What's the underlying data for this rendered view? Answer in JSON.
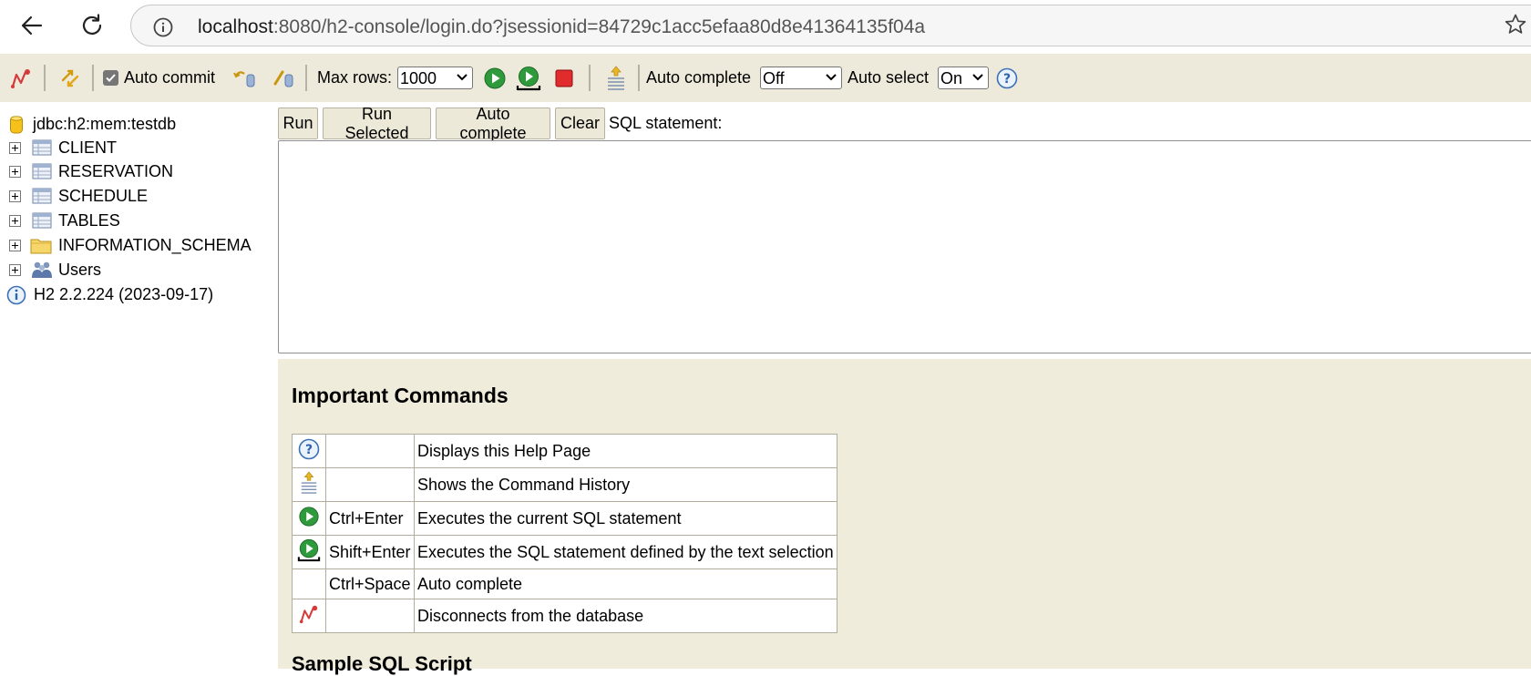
{
  "browser": {
    "url_host": "localhost",
    "url_rest": ":8080/h2-console/login.do?jsessionid=84729c1acc5efaa80d8e41364135f04a"
  },
  "toolbar": {
    "auto_commit_label": "Auto commit",
    "auto_commit_checked": true,
    "max_rows_label": "Max rows:",
    "max_rows_value": "1000",
    "auto_complete_label": "Auto complete",
    "auto_complete_value": "Off",
    "auto_select_label": "Auto select",
    "auto_select_value": "On"
  },
  "tree": {
    "connection": "jdbc:h2:mem:testdb",
    "items": [
      {
        "label": "CLIENT",
        "icon": "table-icon"
      },
      {
        "label": "RESERVATION",
        "icon": "table-icon"
      },
      {
        "label": "SCHEDULE",
        "icon": "table-icon"
      },
      {
        "label": "TABLES",
        "icon": "table-icon"
      },
      {
        "label": "INFORMATION_SCHEMA",
        "icon": "folder-icon"
      },
      {
        "label": "Users",
        "icon": "users-icon"
      }
    ],
    "version": "H2 2.2.224 (2023-09-17)"
  },
  "query": {
    "run_label": "Run",
    "run_selected_label": "Run Selected",
    "auto_complete_label": "Auto complete",
    "clear_label": "Clear",
    "sql_label": "SQL statement:",
    "sql_value": ""
  },
  "help": {
    "title": "Important Commands",
    "rows": [
      {
        "icon": "help-icon",
        "key": "",
        "desc": "Displays this Help Page"
      },
      {
        "icon": "history-icon",
        "key": "",
        "desc": "Shows the Command History"
      },
      {
        "icon": "run-icon",
        "key": "Ctrl+Enter",
        "desc": "Executes the current SQL statement"
      },
      {
        "icon": "run-selected-icon",
        "key": "Shift+Enter",
        "desc": "Executes the SQL statement defined by the text selection"
      },
      {
        "icon": "",
        "key": "Ctrl+Space",
        "desc": "Auto complete"
      },
      {
        "icon": "disconnect-icon",
        "key": "",
        "desc": "Disconnects from the database"
      }
    ],
    "next_section_partial": "Sample SQL Script"
  }
}
